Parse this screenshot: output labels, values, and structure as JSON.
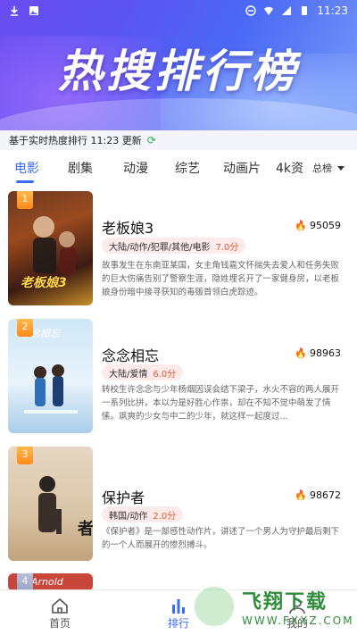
{
  "status_bar": {
    "time": "11:23"
  },
  "header": {
    "title": "热搜排行榜"
  },
  "update_line": {
    "text": "基于实时热度排行 11:23 更新"
  },
  "tabs": [
    {
      "label": "电影"
    },
    {
      "label": "剧集"
    },
    {
      "label": "动漫"
    },
    {
      "label": "综艺"
    },
    {
      "label": "动画片"
    },
    {
      "label": "4k资"
    }
  ],
  "region_filter": {
    "label": "总榜"
  },
  "items": [
    {
      "rank": "1",
      "title": "老板娘3",
      "hot": "95059",
      "tags": "大陆/动作/犯罪/其他/电影",
      "score": "7.0分",
      "desc": "故事发生在东南亚某国，女主角钱嘉文怀揣失去爱人和任务失败的巨大伤痛告别了警察生涯，隐姓埋名开了一家健身房，以老板娘身份暗中接寻获知的毒贩首领白虎踪迹。"
    },
    {
      "rank": "2",
      "title": "念念相忘",
      "hot": "98963",
      "tags": "大陆/爱情",
      "score": "6.0分",
      "desc": "转校生许念念与少年杨烟因误会结下梁子，水火不容的两人展开一系列比拼，本以为是好胜心作祟，却在不知不觉中萌发了情愫。飒爽的少女与中二的少年，就这样一起度过..."
    },
    {
      "rank": "3",
      "title": "保护者",
      "hot": "98672",
      "tags": "韩国/动作",
      "score": "2.0分",
      "desc": "《保护者》是一部感性动作片，讲述了一个男人为守护最后剩下的一个人而展开的惨烈搏斗。"
    },
    {
      "rank": "4",
      "title": "",
      "hot": "",
      "tags": "",
      "score": "",
      "desc": ""
    }
  ],
  "poster_texts": {
    "p1": "老板娘3",
    "p2": "念念相忘",
    "p3": "保护者",
    "p4": "Arnold"
  },
  "bottom_nav": [
    {
      "label": "首页"
    },
    {
      "label": "排行"
    },
    {
      "label": "我的"
    }
  ],
  "watermark": {
    "main": "飞翔下载",
    "sub": "WWW.FXXZ.COM"
  },
  "colors": {
    "accent": "#3a6cf0",
    "header_start": "#6a4cf0",
    "header_end": "#7a9cf8",
    "flame": "#e0392b",
    "score": "#e25b2a"
  }
}
